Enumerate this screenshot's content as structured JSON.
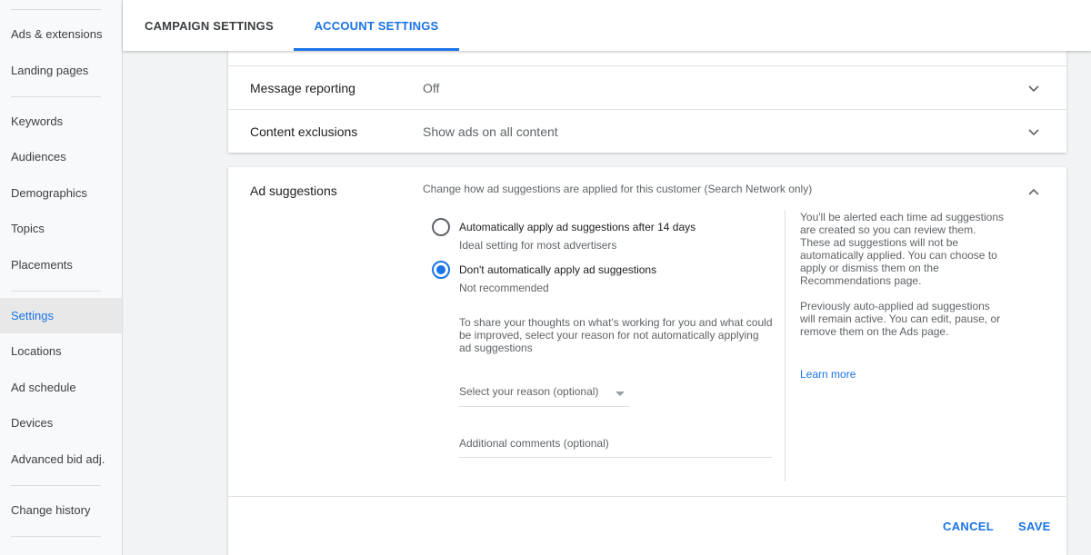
{
  "sidebar": {
    "items": [
      {
        "label": "Ads & extensions"
      },
      {
        "label": "Landing pages"
      },
      {
        "label": "Keywords"
      },
      {
        "label": "Audiences"
      },
      {
        "label": "Demographics"
      },
      {
        "label": "Topics"
      },
      {
        "label": "Placements"
      },
      {
        "label": "Settings"
      },
      {
        "label": "Locations"
      },
      {
        "label": "Ad schedule"
      },
      {
        "label": "Devices"
      },
      {
        "label": "Advanced bid adj."
      },
      {
        "label": "Change history"
      }
    ],
    "active": "Settings"
  },
  "tabs": {
    "campaign": "CAMPAIGN SETTINGS",
    "account": "ACCOUNT SETTINGS",
    "active": "ACCOUNT SETTINGS"
  },
  "settings_rows": [
    {
      "label": "Message reporting",
      "value": "Off"
    },
    {
      "label": "Content exclusions",
      "value": "Show ads on all content"
    }
  ],
  "ad_suggestions": {
    "title": "Ad suggestions",
    "description": "Change how ad suggestions are applied for this customer (Search Network only)",
    "options": [
      {
        "label": "Automatically apply ad suggestions after 14 days",
        "sub": "Ideal setting for most advertisers",
        "checked": false
      },
      {
        "label": "Don't automatically apply ad suggestions",
        "sub": "Not recommended",
        "checked": true
      }
    ],
    "share_text": "To share your thoughts on what's working for you and what could be improved, select your reason for not automatically applying ad suggestions",
    "reason_select": "Select your reason (optional)",
    "comments_placeholder": "Additional comments (optional)",
    "info_1": "You'll be alerted each time ad suggestions are created so you can review them. These ad suggestions will not be automatically applied. You can choose to apply or dismiss them on the Recommendations page.",
    "info_2": "Previously auto-applied ad suggestions will remain active. You can edit, pause, or remove them on the Ads page.",
    "learn_more": "Learn more"
  },
  "actions": {
    "cancel": "CANCEL",
    "save": "SAVE"
  },
  "colors": {
    "accent": "#1a73e8",
    "active_bg": "#e8e8e8"
  }
}
